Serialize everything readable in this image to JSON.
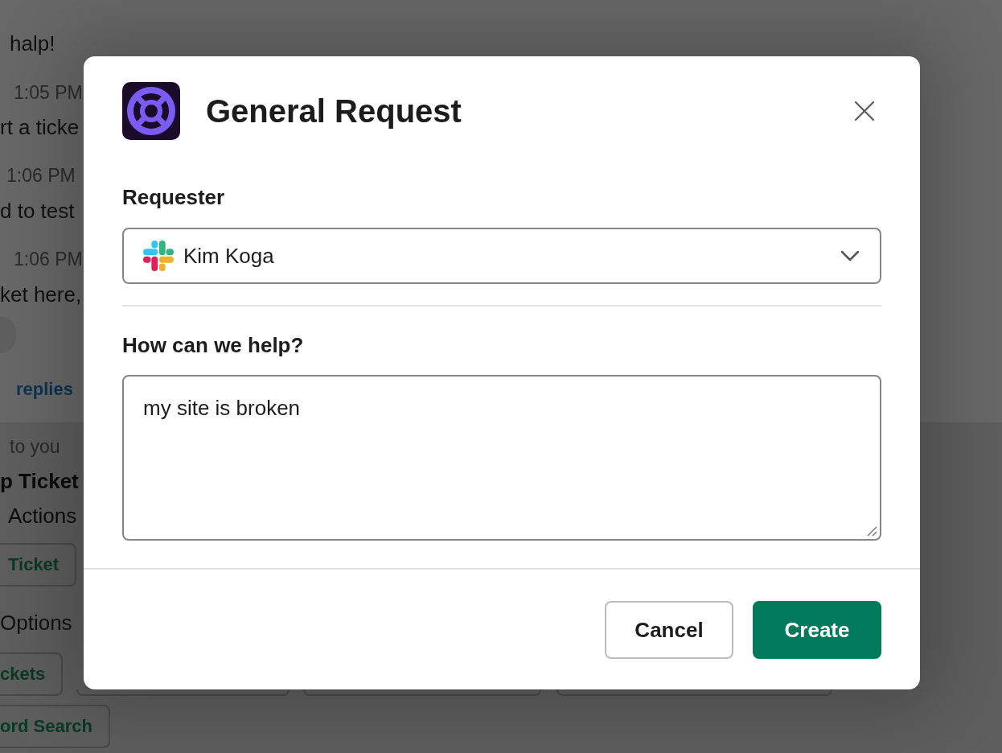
{
  "conversation": {
    "lines": [
      {
        "kind": "message",
        "text": "halp!"
      },
      {
        "kind": "time",
        "text": "1:05 PM"
      },
      {
        "kind": "message",
        "text": "rt a ticke"
      },
      {
        "kind": "time",
        "text": "1:06 PM"
      },
      {
        "kind": "message",
        "text": "d to test"
      },
      {
        "kind": "time",
        "text": "1:06 PM"
      },
      {
        "kind": "message",
        "text": "ket here,"
      },
      {
        "kind": "reaction"
      },
      {
        "kind": "link",
        "text": "replies"
      }
    ]
  },
  "bot_message": {
    "context": "to you",
    "title": "p Ticket",
    "subtitle": "Actions",
    "action_button": "Ticket",
    "options_label": "Options",
    "option_rows": [
      {
        "buttons": [
          {
            "label": "ckets",
            "covered": false
          },
          {
            "covered": true
          },
          {
            "covered": true
          },
          {
            "covered": true
          }
        ]
      },
      {
        "buttons": [
          {
            "label": "ord Search",
            "covered": false
          }
        ]
      }
    ]
  },
  "modal": {
    "title": "General Request",
    "fields": [
      {
        "kind": "select",
        "label": "Requester",
        "value": "Kim Koga"
      },
      {
        "kind": "textarea",
        "label": "How can we help?",
        "value": "my site is broken"
      }
    ],
    "buttons": [
      {
        "kind": "secondary",
        "label": "Cancel"
      },
      {
        "kind": "primary",
        "label": "Create"
      }
    ]
  }
}
